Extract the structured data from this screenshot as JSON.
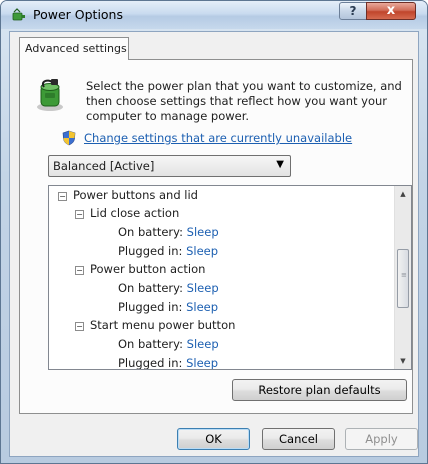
{
  "window": {
    "title": "Power Options",
    "help_label": "?",
    "close_label": "x"
  },
  "tab": {
    "label": "Advanced settings"
  },
  "intro": {
    "line1": "Select the power plan that you want to customize, and",
    "line2": "then choose settings that reflect how you want your",
    "line3": "computer to manage power."
  },
  "change_link": "Change settings that are currently unavailable",
  "plan_select": {
    "value": "Balanced [Active]"
  },
  "tree": {
    "group": "Power buttons and lid",
    "lid_close": {
      "label": "Lid close action",
      "on_battery_label": "On battery:",
      "on_battery_value": "Sleep",
      "plugged_label": "Plugged in:",
      "plugged_value": "Sleep"
    },
    "power_button": {
      "label": "Power button action",
      "on_battery_label": "On battery:",
      "on_battery_value": "Sleep",
      "plugged_label": "Plugged in:",
      "plugged_value": "Sleep"
    },
    "start_menu": {
      "label": "Start menu power button",
      "on_battery_label": "On battery:",
      "on_battery_value": "Sleep",
      "plugged_label": "Plugged in:",
      "plugged_value": "Sleep"
    }
  },
  "buttons": {
    "restore": "Restore plan defaults",
    "ok": "OK",
    "cancel": "Cancel",
    "apply": "Apply"
  },
  "colors": {
    "link": "#1c5fb1",
    "close_button": "#c0452c"
  }
}
